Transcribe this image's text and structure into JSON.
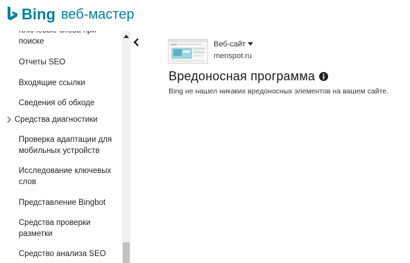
{
  "header": {
    "logo_text": "Bing",
    "app_name": "веб-мастер"
  },
  "sidebar": {
    "items": [
      {
        "label": "Ключевые слова при поиске",
        "type": "link"
      },
      {
        "label": "Отчеты SEO",
        "type": "link"
      },
      {
        "label": "Входящие ссылки",
        "type": "link"
      },
      {
        "label": "Сведения об обходе",
        "type": "link"
      },
      {
        "label": "Средства диагностики",
        "type": "section"
      },
      {
        "label": "Проверка адаптации для мобильных устройств",
        "type": "link"
      },
      {
        "label": "Исследование ключевых слов",
        "type": "link"
      },
      {
        "label": "Представление Bingbot",
        "type": "link"
      },
      {
        "label": "Средства проверки разметки",
        "type": "link"
      },
      {
        "label": "Средство анализа SEO",
        "type": "link"
      }
    ]
  },
  "site": {
    "label": "Веб-сайт",
    "domain": "menspot.ru"
  },
  "main": {
    "title": "Вредоносная программа",
    "message": "Bing не нашел никаких вредоносных элементов на вашем сайте."
  },
  "colors": {
    "brand": "#00809d",
    "scroll_thumb": "#c2c2c2",
    "scroll_track": "#f0f0f0"
  },
  "icons": {
    "logo": "bing-logo-icon",
    "section_toggle": "chevron-right-icon",
    "collapse": "chevron-left-icon",
    "dropdown": "caret-down-icon",
    "info": "info-icon",
    "scroll_up": "scroll-up-arrow-icon"
  }
}
